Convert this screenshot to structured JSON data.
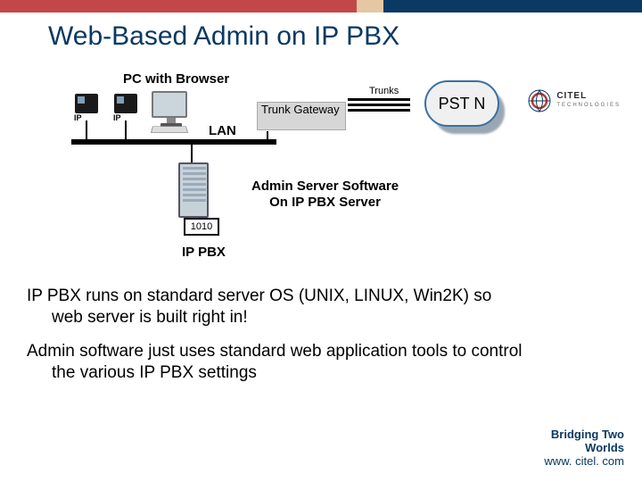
{
  "title": "Web-Based Admin on IP PBX",
  "logo": {
    "name": "CITEL",
    "sub": "TECHNOLOGIES"
  },
  "diagram": {
    "pc_label": "PC with Browser",
    "ip_tag": "IP",
    "lan_label": "LAN",
    "trunk_gateway": "Trunk Gateway",
    "trunks_label": "Trunks",
    "cloud": "PST N",
    "server_code": "1010",
    "pbx_label": "IP PBX",
    "admin_note_l1": "Admin Server Software",
    "admin_note_l2": "On IP PBX Server"
  },
  "bullets": [
    "IP PBX runs on standard server OS (UNIX, LINUX, Win2K) so web server is built right in!",
    "Admin software just uses standard web application tools to control the various IP PBX settings"
  ],
  "footer": {
    "l1": "Bridging Two",
    "l2": "Worlds",
    "url": "www. citel. com"
  }
}
